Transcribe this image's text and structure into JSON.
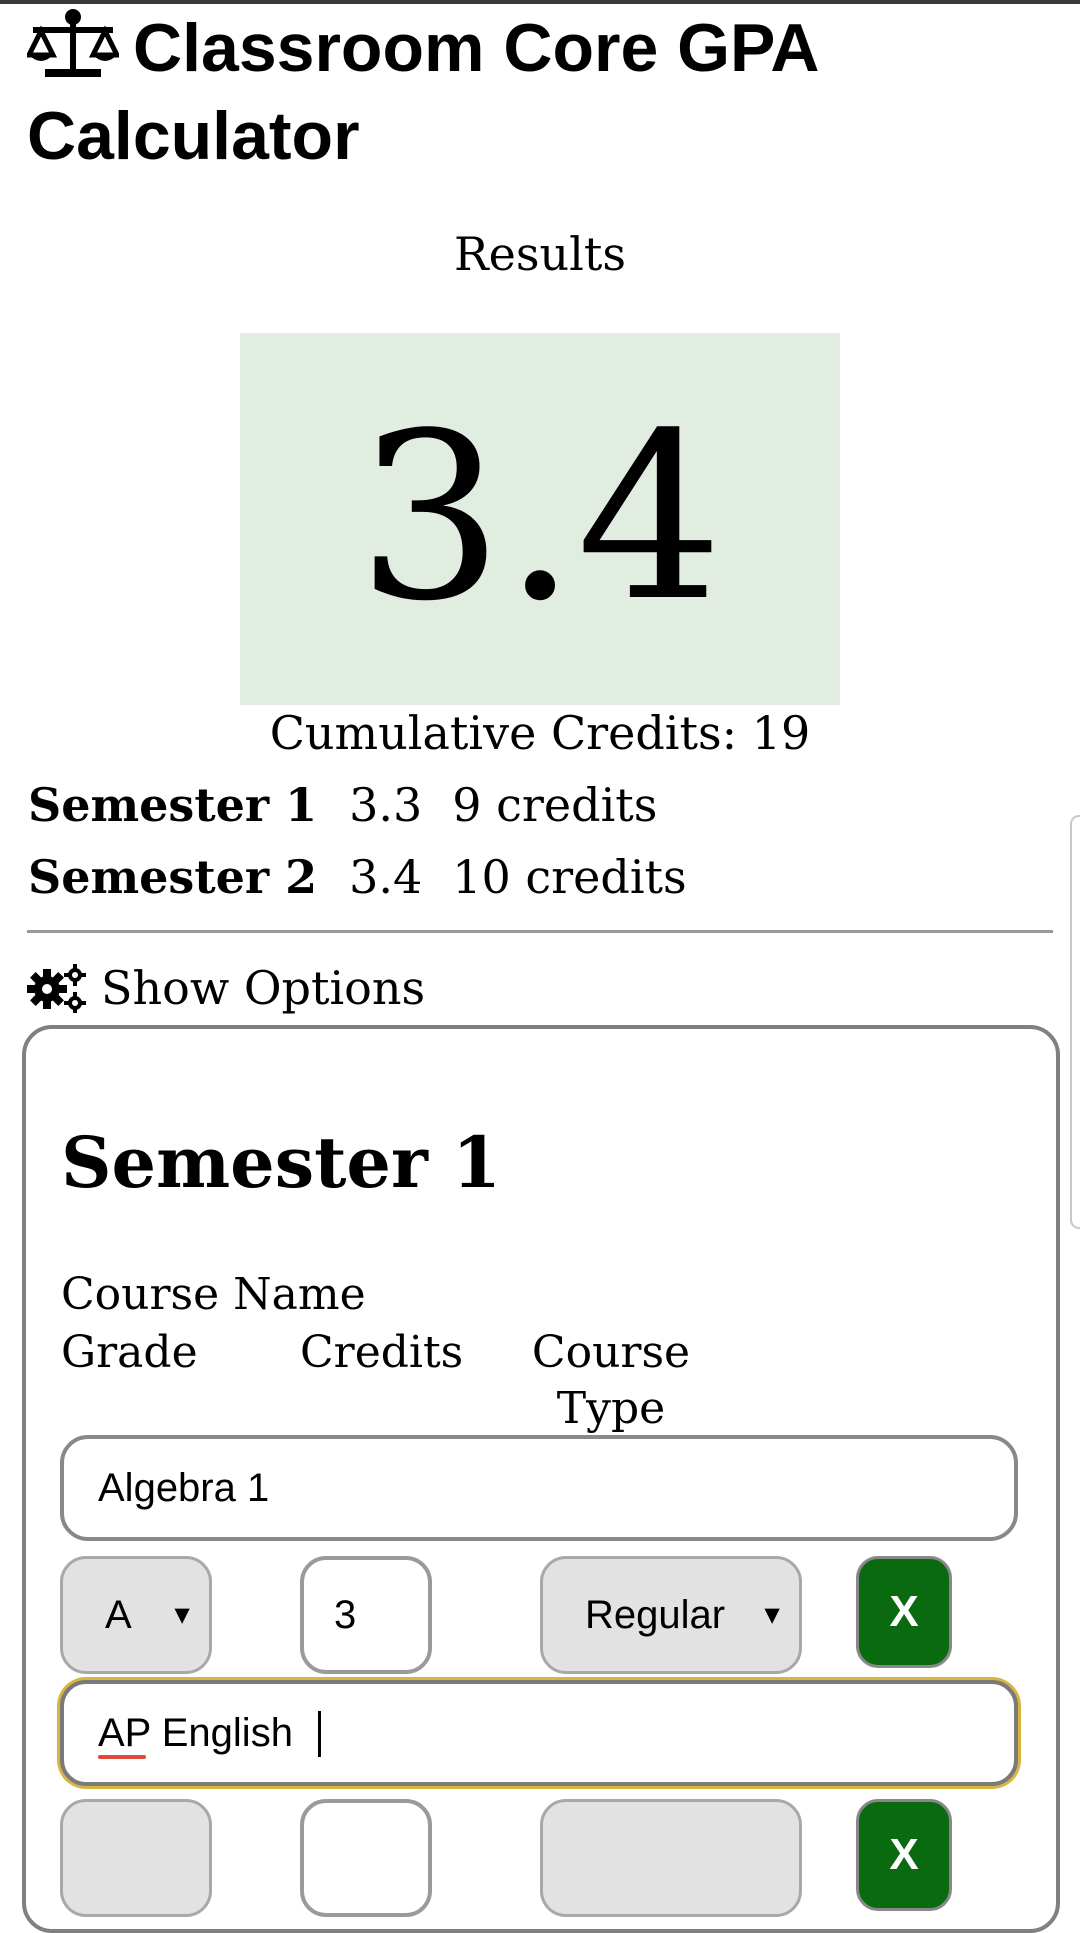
{
  "header": {
    "icon": "balance-scale-icon",
    "title": "Classroom Core GPA Calculator"
  },
  "results": {
    "heading": "Results",
    "gpa": "3.4",
    "cumulative_credits": "Cumulative Credits: 19",
    "gpa_box_color": "#e2ede1",
    "semesters": [
      {
        "name": "Semester 1",
        "gpa": "3.3",
        "credits": "9 credits"
      },
      {
        "name": "Semester 2",
        "gpa": "3.4",
        "credits": "10 credits"
      }
    ]
  },
  "options": {
    "icon": "gears-icon",
    "label": "Show Options"
  },
  "semester_card": {
    "title": "Semester 1",
    "labels": {
      "course_name": "Course Name",
      "grade": "Grade",
      "credits": "Credits",
      "course_type": "Course Type"
    },
    "courses": [
      {
        "name": "Algebra 1",
        "grade": "A",
        "credits": "3",
        "type": "Regular",
        "remove_label": "X"
      },
      {
        "name": "AP English",
        "grade": "",
        "credits": "",
        "type": "",
        "remove_label": "X"
      }
    ],
    "remove_button_color": "#0a6a10",
    "focus_color": "#d8b540"
  }
}
